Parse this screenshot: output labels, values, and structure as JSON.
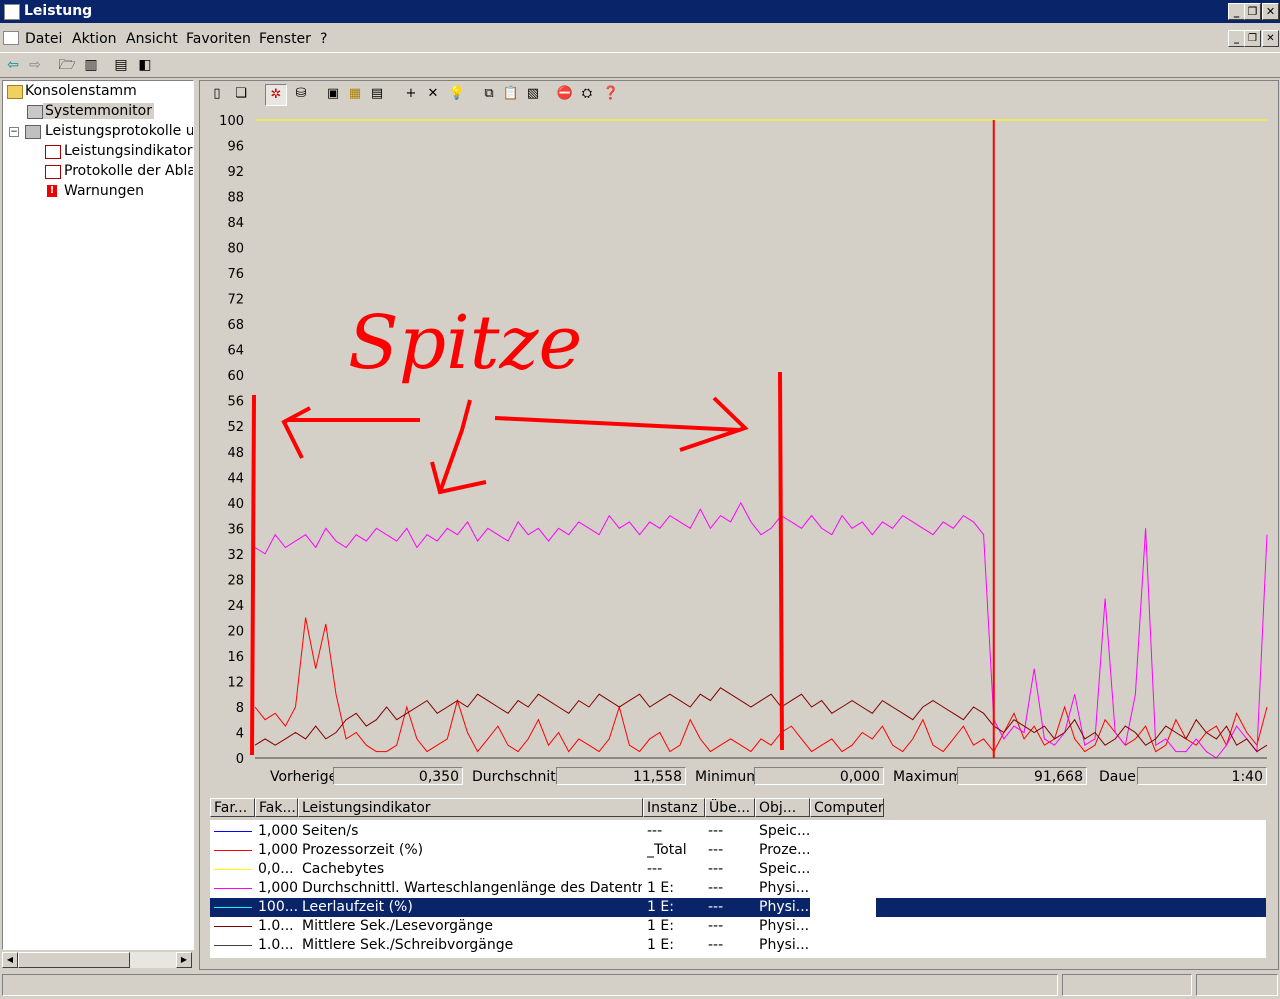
{
  "window": {
    "title": "Leistung",
    "caption_min": "_",
    "caption_restore": "❐",
    "caption_close": "✕"
  },
  "menu": [
    "Datei",
    "Aktion",
    "Ansicht",
    "Favoriten",
    "Fenster",
    "?"
  ],
  "tree": {
    "root": "Konsolenstamm",
    "systemmonitor": "Systemmonitor",
    "logs": "Leistungsprotokolle und Warnungen",
    "counter_logs": "Leistungsindikatorenprotokolle",
    "trace_logs": "Protokolle der Ablaufverfolgung",
    "alerts": "Warnungen"
  },
  "chart_data": {
    "type": "line",
    "ylim": [
      0,
      100
    ],
    "y_ticks": [
      "100",
      "96",
      "92",
      "88",
      "84",
      "80",
      "76",
      "72",
      "68",
      "64",
      "60",
      "56",
      "52",
      "48",
      "44",
      "40",
      "36",
      "32",
      "28",
      "24",
      "20",
      "16",
      "12",
      "8",
      "4",
      "0"
    ],
    "x_points": 101,
    "time_bar_index": 73,
    "series": [
      {
        "name": "Seiten/s",
        "color": "#0000ff",
        "values": [
          0,
          0,
          0,
          0,
          0,
          0,
          0,
          0,
          0,
          0,
          0,
          0,
          0,
          0,
          0,
          0,
          0,
          0,
          0,
          0,
          0,
          0,
          0,
          0,
          0,
          0,
          0,
          0,
          0,
          0,
          0,
          0,
          0,
          0,
          0,
          0,
          0,
          0,
          0,
          0,
          0,
          0,
          0,
          0,
          0,
          0,
          0,
          0,
          0,
          0,
          0,
          0,
          0,
          0,
          0,
          0,
          0,
          0,
          0,
          0,
          0,
          0,
          0,
          0,
          0,
          0,
          0,
          0,
          0,
          0,
          0,
          0,
          0,
          0,
          0,
          0,
          0,
          0,
          0,
          0,
          0,
          0,
          0,
          0,
          0,
          0,
          0,
          0,
          0,
          0,
          0,
          0,
          0,
          0,
          0,
          0,
          0,
          0,
          0,
          0,
          0
        ]
      },
      {
        "name": "Prozessorzeit (%)",
        "color": "#ff0000",
        "values": [
          8,
          6,
          7,
          5,
          8,
          22,
          14,
          21,
          10,
          3,
          4,
          2,
          1,
          1,
          2,
          8,
          3,
          1,
          2,
          3,
          9,
          4,
          1,
          3,
          5,
          2,
          1,
          3,
          6,
          2,
          4,
          1,
          3,
          2,
          1,
          3,
          8,
          2,
          1,
          3,
          4,
          1,
          2,
          6,
          3,
          1,
          2,
          3,
          2,
          1,
          3,
          2,
          4,
          5,
          3,
          1,
          2,
          3,
          1,
          2,
          4,
          3,
          5,
          2,
          1,
          3,
          6,
          2,
          1,
          3,
          5,
          2,
          3,
          1,
          4,
          7,
          3,
          5,
          2,
          3,
          8,
          3,
          1,
          2,
          6,
          4,
          2,
          3,
          5,
          1,
          2,
          6,
          3,
          2,
          4,
          5,
          2,
          7,
          4,
          2,
          8
        ]
      },
      {
        "name": "Cachebytes",
        "color": "#ffff00",
        "values": [
          100,
          100,
          100,
          100,
          100,
          100,
          100,
          100,
          100,
          100,
          100,
          100,
          100,
          100,
          100,
          100,
          100,
          100,
          100,
          100,
          100,
          100,
          100,
          100,
          100,
          100,
          100,
          100,
          100,
          100,
          100,
          100,
          100,
          100,
          100,
          100,
          100,
          100,
          100,
          100,
          100,
          100,
          100,
          100,
          100,
          100,
          100,
          100,
          100,
          100,
          100,
          100,
          100,
          100,
          100,
          100,
          100,
          100,
          100,
          100,
          100,
          100,
          100,
          100,
          100,
          100,
          100,
          100,
          100,
          100,
          100,
          100,
          100,
          100,
          100,
          100,
          100,
          100,
          100,
          100,
          100,
          100,
          100,
          100,
          100,
          100,
          100,
          100,
          100,
          100,
          100,
          100,
          100,
          100,
          100,
          100,
          100,
          100,
          100,
          100,
          100
        ]
      },
      {
        "name": "Durchschnittl. Warteschlangenlänge des Datenträgers",
        "color": "#ff00ff",
        "values": [
          33,
          32,
          35,
          33,
          34,
          35,
          33,
          36,
          34,
          33,
          35,
          34,
          36,
          35,
          34,
          36,
          33,
          35,
          34,
          36,
          35,
          37,
          34,
          36,
          35,
          34,
          37,
          35,
          36,
          34,
          36,
          35,
          37,
          36,
          35,
          38,
          36,
          37,
          35,
          37,
          36,
          38,
          37,
          36,
          39,
          36,
          38,
          37,
          40,
          37,
          35,
          36,
          38,
          37,
          36,
          38,
          36,
          35,
          38,
          36,
          37,
          35,
          37,
          36,
          38,
          37,
          36,
          35,
          37,
          36,
          38,
          37,
          35,
          6,
          3,
          5,
          4,
          14,
          3,
          2,
          4,
          10,
          2,
          3,
          25,
          4,
          2,
          10,
          36,
          2,
          3,
          1,
          1,
          3,
          1,
          0,
          2,
          5,
          3,
          1,
          35
        ]
      },
      {
        "name": "Leerlaufzeit (%)",
        "color": "#00ffff",
        "values": [
          0,
          0,
          0,
          0,
          0,
          0,
          0,
          0,
          0,
          0,
          0,
          0,
          0,
          0,
          0,
          0,
          0,
          0,
          0,
          0,
          0,
          0,
          0,
          0,
          0,
          0,
          0,
          0,
          0,
          0,
          0,
          0,
          0,
          0,
          0,
          0,
          0,
          0,
          0,
          0,
          0,
          0,
          0,
          0,
          0,
          0,
          0,
          0,
          0,
          0,
          0,
          0,
          0,
          0,
          0,
          0,
          0,
          0,
          0,
          0,
          0,
          0,
          0,
          0,
          0,
          0,
          0,
          0,
          0,
          0,
          0,
          0,
          0,
          0,
          0,
          0,
          0,
          0,
          0,
          0,
          0,
          0,
          0,
          0,
          0,
          0,
          0,
          0,
          0,
          0,
          0,
          0,
          0,
          0,
          0,
          0,
          0,
          0,
          0,
          0,
          0
        ]
      },
      {
        "name": "Mittlere Sek./Lesevorgänge",
        "color": "#800000",
        "values": [
          2,
          3,
          2,
          3,
          4,
          3,
          5,
          3,
          4,
          6,
          7,
          5,
          6,
          8,
          6,
          7,
          8,
          9,
          7,
          8,
          9,
          8,
          10,
          9,
          8,
          7,
          9,
          8,
          10,
          9,
          8,
          7,
          9,
          8,
          10,
          9,
          8,
          9,
          10,
          8,
          9,
          10,
          9,
          8,
          10,
          9,
          11,
          10,
          9,
          8,
          9,
          10,
          8,
          9,
          10,
          8,
          9,
          7,
          8,
          9,
          8,
          7,
          9,
          8,
          7,
          6,
          8,
          9,
          8,
          7,
          6,
          8,
          7,
          5,
          4,
          6,
          5,
          4,
          5,
          3,
          4,
          6,
          3,
          4,
          2,
          3,
          5,
          4,
          2,
          3,
          5,
          4,
          3,
          6,
          4,
          3,
          5,
          2,
          3,
          1,
          2
        ]
      },
      {
        "name": "Mittlere Sek./Schreibvorgänge",
        "color": "#404040",
        "values": [
          0,
          0,
          0,
          0,
          0,
          0,
          0,
          0,
          0,
          0,
          0,
          0,
          0,
          0,
          0,
          0,
          0,
          0,
          0,
          0,
          0,
          0,
          0,
          0,
          0,
          0,
          0,
          0,
          0,
          0,
          0,
          0,
          0,
          0,
          0,
          0,
          0,
          0,
          0,
          0,
          0,
          0,
          0,
          0,
          0,
          0,
          0,
          0,
          0,
          0,
          0,
          0,
          0,
          0,
          0,
          0,
          0,
          0,
          0,
          0,
          0,
          0,
          0,
          0,
          0,
          0,
          0,
          0,
          0,
          0,
          0,
          0,
          0,
          0,
          0,
          0,
          0,
          0,
          0,
          0,
          0,
          0,
          0,
          0,
          0,
          0,
          0,
          0,
          0,
          0,
          0,
          0,
          0,
          0,
          0,
          0,
          0,
          0,
          0,
          0,
          0
        ]
      }
    ],
    "annotation": "Spitze"
  },
  "stats": {
    "last_label": "Vorherige",
    "last_value": "0,350",
    "avg_label": "Durchschnitt",
    "avg_value": "11,558",
    "min_label": "Minimum",
    "min_value": "0,000",
    "max_label": "Maximum",
    "max_value": "91,668",
    "dur_label": "Dauer",
    "dur_value": "1:40"
  },
  "list": {
    "headers": [
      "Far...",
      "Fak...",
      "Leistungsindikator",
      "Instanz",
      "Übe...",
      "Obj...",
      "Computer"
    ],
    "rows": [
      {
        "color": "#0000ff",
        "scale": "1,000",
        "counter": "Seiten/s",
        "instance": "---",
        "parent": "---",
        "object": "Speic...",
        "selected": false
      },
      {
        "color": "#ff0000",
        "scale": "1,000",
        "counter": "Prozessorzeit (%)",
        "instance": "_Total",
        "parent": "---",
        "object": "Proze...",
        "selected": false
      },
      {
        "color": "#ffff00",
        "scale": "0,0...",
        "counter": "Cachebytes",
        "instance": "---",
        "parent": "---",
        "object": "Speic...",
        "selected": false
      },
      {
        "color": "#ff00ff",
        "scale": "1,000",
        "counter": "Durchschnittl. Warteschlangenlänge des Datenträgers",
        "instance": "1 E:",
        "parent": "---",
        "object": "Physi...",
        "selected": false
      },
      {
        "color": "#00ffff",
        "scale": "100...",
        "counter": "Leerlaufzeit (%)",
        "instance": "1 E:",
        "parent": "---",
        "object": "Physi...",
        "selected": true
      },
      {
        "color": "#800000",
        "scale": "1.0...",
        "counter": "Mittlere Sek./Lesevorgänge",
        "instance": "1 E:",
        "parent": "---",
        "object": "Physi...",
        "selected": false
      },
      {
        "color": "#404040",
        "scale": "1.0...",
        "counter": "Mittlere Sek./Schreibvorgänge",
        "instance": "1 E:",
        "parent": "---",
        "object": "Physi...",
        "selected": false
      }
    ]
  }
}
